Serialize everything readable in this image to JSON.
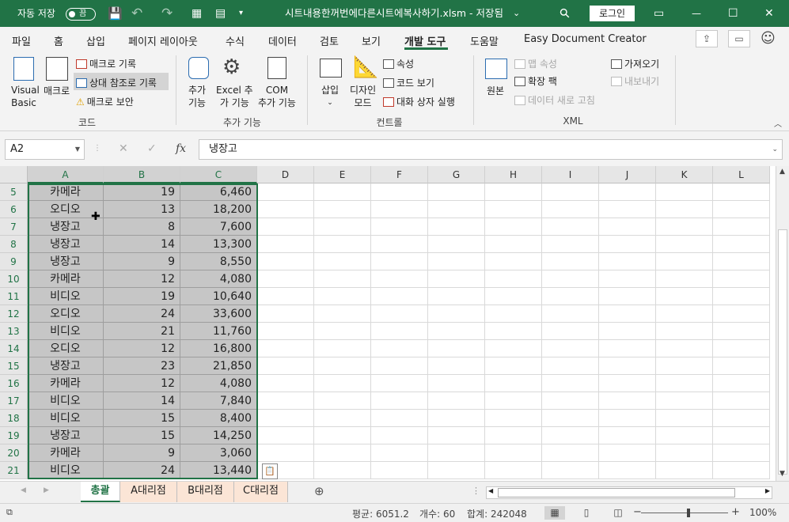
{
  "titlebar": {
    "autosave_label": "자동 저장",
    "autosave_state": "끔",
    "title": "시트내용한꺼번에다른시트에복사하기.xlsm - 저장됨",
    "title_caret": "⌄",
    "login": "로그인",
    "save_icon": "💾",
    "undo_icon": "↶",
    "redo_icon": "↷",
    "search_icon": "⚲",
    "ribbon_display_icon": "▭",
    "minimize_icon": "—",
    "maximize_icon": "☐",
    "close_icon": "✕"
  },
  "tabs": [
    {
      "label": "파일"
    },
    {
      "label": "홈"
    },
    {
      "label": "삽입"
    },
    {
      "label": "페이지 레이아웃"
    },
    {
      "label": "수식"
    },
    {
      "label": "데이터"
    },
    {
      "label": "검토"
    },
    {
      "label": "보기"
    },
    {
      "label": "개발 도구",
      "active": true
    },
    {
      "label": "도움말"
    },
    {
      "label": "Easy Document Creator"
    }
  ],
  "ribbon": {
    "code": {
      "group_label": "코드",
      "visual_basic": [
        "Visual",
        "Basic"
      ],
      "macro": "매크로",
      "record_macro": "매크로 기록",
      "relative_ref": "상대 참조로 기록",
      "macro_security": "매크로 보안"
    },
    "addins": {
      "group_label": "추가 기능",
      "addins": [
        "추가",
        "기능"
      ],
      "excel_addins": [
        "Excel 추",
        "가 기능"
      ],
      "com_addins": [
        "COM",
        "추가 기능"
      ]
    },
    "controls": {
      "group_label": "컨트롤",
      "insert": "삽입",
      "insert_caret": "⌄",
      "design_mode": [
        "디자인",
        "모드"
      ],
      "properties": "속성",
      "view_code": "코드 보기",
      "run_dialog": "대화 상자 실행"
    },
    "xml": {
      "group_label": "XML",
      "source": "원본",
      "map_properties": "맵 속성",
      "expansion_packs": "확장 팩",
      "refresh_data": "데이터 새로 고침",
      "import": "가져오기",
      "export": "내보내기"
    }
  },
  "formula_bar": {
    "name_box": "A2",
    "fx": "fx",
    "formula": "냉장고"
  },
  "columns": [
    "A",
    "B",
    "C",
    "D",
    "E",
    "F",
    "G",
    "H",
    "I",
    "J",
    "K",
    "L"
  ],
  "rows": [
    {
      "n": "5",
      "a": "카메라",
      "b": "19",
      "c": "6,460"
    },
    {
      "n": "6",
      "a": "오디오",
      "b": "13",
      "c": "18,200"
    },
    {
      "n": "7",
      "a": "냉장고",
      "b": "8",
      "c": "7,600"
    },
    {
      "n": "8",
      "a": "냉장고",
      "b": "14",
      "c": "13,300"
    },
    {
      "n": "9",
      "a": "냉장고",
      "b": "9",
      "c": "8,550"
    },
    {
      "n": "10",
      "a": "카메라",
      "b": "12",
      "c": "4,080"
    },
    {
      "n": "11",
      "a": "비디오",
      "b": "19",
      "c": "10,640"
    },
    {
      "n": "12",
      "a": "오디오",
      "b": "24",
      "c": "33,600"
    },
    {
      "n": "13",
      "a": "비디오",
      "b": "21",
      "c": "11,760"
    },
    {
      "n": "14",
      "a": "오디오",
      "b": "12",
      "c": "16,800"
    },
    {
      "n": "15",
      "a": "냉장고",
      "b": "23",
      "c": "21,850"
    },
    {
      "n": "16",
      "a": "카메라",
      "b": "12",
      "c": "4,080"
    },
    {
      "n": "17",
      "a": "비디오",
      "b": "14",
      "c": "7,840"
    },
    {
      "n": "18",
      "a": "비디오",
      "b": "15",
      "c": "8,400"
    },
    {
      "n": "19",
      "a": "냉장고",
      "b": "15",
      "c": "14,250"
    },
    {
      "n": "20",
      "a": "카메라",
      "b": "9",
      "c": "3,060"
    },
    {
      "n": "21",
      "a": "비디오",
      "b": "24",
      "c": "13,440"
    }
  ],
  "sheets": [
    {
      "label": "총괄",
      "active": true
    },
    {
      "label": "A대리점"
    },
    {
      "label": "B대리점"
    },
    {
      "label": "C대리점"
    }
  ],
  "status": {
    "average": "평균: 6051.2",
    "count": "개수: 60",
    "sum": "합계: 242048",
    "zoom": "100%",
    "zoom_minus": "−",
    "zoom_plus": "+"
  }
}
